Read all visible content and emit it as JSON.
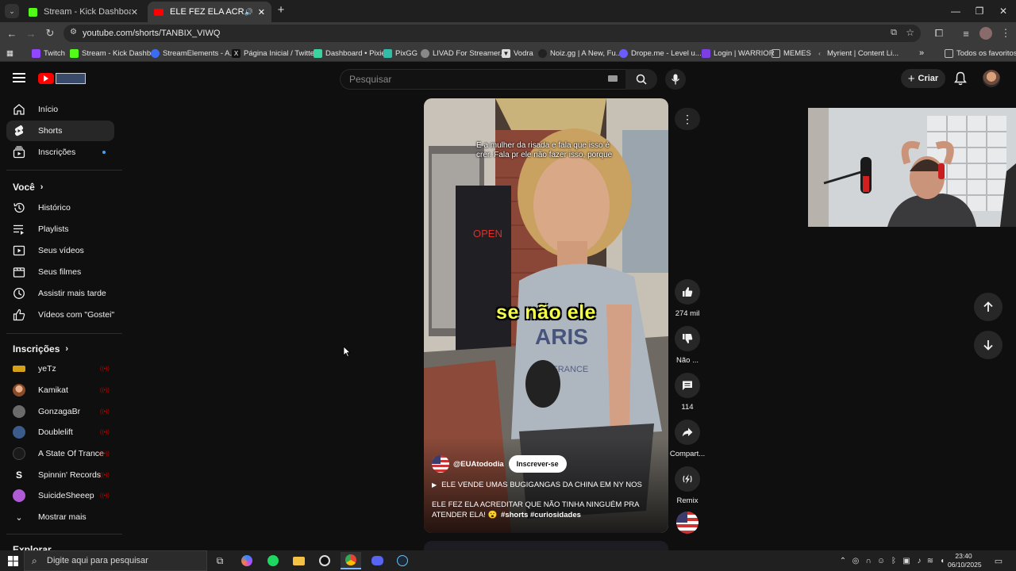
{
  "browser": {
    "tabs": [
      {
        "title": "Stream - Kick Dashboard",
        "active": false
      },
      {
        "title": "ELE FEZ ELA ACREDITAR QUE...",
        "active": true
      }
    ],
    "new_tab": "+",
    "url": "youtube.com/shorts/TANBIX_VIWQ",
    "bookmarks": [
      {
        "label": "Twitch",
        "icon": "twitch-icon",
        "color": "#9146ff"
      },
      {
        "label": "Stream - Kick Dashb...",
        "icon": "kick-icon",
        "color": "#53fc18"
      },
      {
        "label": "StreamElements - A...",
        "icon": "streamelements-icon",
        "color": "#3c6cf2"
      },
      {
        "label": "Página Inicial / Twitter",
        "icon": "x-icon",
        "color": "#111111"
      },
      {
        "label": "Dashboard • Pixie",
        "icon": "pixie-icon",
        "color": "#3ad29f"
      },
      {
        "label": "PixGG",
        "icon": "pixgg-icon",
        "color": "#32bca8"
      },
      {
        "label": "LIVAD For Streamer...",
        "icon": "livad-icon",
        "color": "#888888"
      },
      {
        "label": "Vodra",
        "icon": "vodra-icon",
        "color": "#dddddd"
      },
      {
        "label": "Noiz.gg | A New, Fu...",
        "icon": "noiz-icon",
        "color": "#222222"
      },
      {
        "label": "Drope.me - Level u...",
        "icon": "drope-icon",
        "color": "#6a5cff"
      },
      {
        "label": "Login | WARRIOR",
        "icon": "warrior-icon",
        "color": "#7b3fe4"
      },
      {
        "label": "MEMES",
        "icon": "folder-icon",
        "color": "#bbbbbb"
      },
      {
        "label": "Myrient | Content Li...",
        "icon": "myrient-icon",
        "color": "#888888"
      }
    ],
    "all_bookmarks": "Todos os favoritos"
  },
  "youtube": {
    "search_placeholder": "Pesquisar",
    "create_label": "Criar",
    "sidebar": {
      "main": [
        {
          "label": "Início",
          "icon": "home-icon"
        },
        {
          "label": "Shorts",
          "icon": "shorts-icon",
          "active": true
        },
        {
          "label": "Inscrições",
          "icon": "subscriptions-icon"
        }
      ],
      "you_heading": "Você",
      "you": [
        {
          "label": "Histórico",
          "icon": "history-icon"
        },
        {
          "label": "Playlists",
          "icon": "playlists-icon"
        },
        {
          "label": "Seus vídeos",
          "icon": "your-videos-icon"
        },
        {
          "label": "Seus filmes",
          "icon": "your-movies-icon"
        },
        {
          "label": "Assistir mais tarde",
          "icon": "watch-later-icon"
        },
        {
          "label": "Vídeos com \"Gostei\"",
          "icon": "liked-icon"
        }
      ],
      "subs_heading": "Inscrições",
      "subscriptions": [
        {
          "label": "yeTz",
          "color": "#d4a017"
        },
        {
          "label": "Kamikat",
          "color": "#c47b4a"
        },
        {
          "label": "GonzagaBr",
          "color": "#6b6b6b"
        },
        {
          "label": "Doublelift",
          "color": "#3b5b8a"
        },
        {
          "label": "A State Of Trance",
          "color": "#1a1a1a"
        },
        {
          "label": "Spinnin' Records",
          "color": "#ffffff"
        },
        {
          "label": "SuicideSheeep",
          "color": "#b05bd6"
        }
      ],
      "show_more": "Mostrar mais",
      "explore_heading": "Explorar"
    },
    "short": {
      "caption_top_line1": "E a mulher da risada e fala que isso é",
      "caption_top_line2": "crer. Fala pr ele não fazer isso, porque",
      "caption_big": "se não ele",
      "channel": "@EUAtododia",
      "subscribe": "Inscrever-se",
      "sound": "ELE VENDE UMAS BUGIGANGAS DA CHINA EM NY NOS",
      "description": "ELE FEZ ELA ACREDITAR QUE NÃO TINHA NINGUÉM PRA ATENDER ELA! 😮",
      "hashtags": "#shorts #curiosidades"
    },
    "actions": {
      "likes": "274 mil",
      "dislike": "Não ...",
      "comments": "114",
      "share": "Compart...",
      "remix": "Remix"
    }
  },
  "taskbar": {
    "search_placeholder": "Digite aqui para pesquisar",
    "time": "23:40",
    "date": "06/10/2025"
  }
}
